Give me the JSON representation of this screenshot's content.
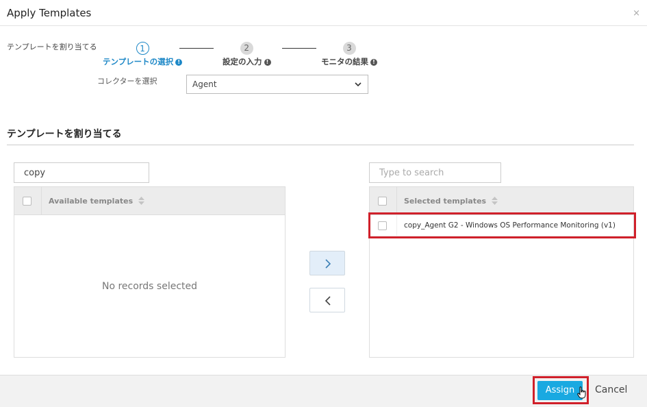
{
  "dialog": {
    "title": "Apply Templates",
    "close_glyph": "×"
  },
  "assign_label": "テンプレートを割り当てる",
  "steps": [
    {
      "number": "1",
      "label": "テンプレートの選択",
      "state": "active"
    },
    {
      "number": "2",
      "label": "設定の入力",
      "state": "inactive"
    },
    {
      "number": "3",
      "label": "モニタの結果",
      "state": "inactive"
    }
  ],
  "collector": {
    "label": "コレクターを選択",
    "value": "Agent"
  },
  "section_title": "テンプレートを割り当てる",
  "available": {
    "search_value": "copy",
    "column_header": "Available templates",
    "empty_text": "No records selected"
  },
  "selected": {
    "search_placeholder": "Type to search",
    "column_header": "Selected templates",
    "rows": [
      "copy_Agent G2 - Windows OS Performance Monitoring (v1)"
    ]
  },
  "footer": {
    "assign_label": "Assign",
    "cancel_label": "Cancel"
  },
  "colors": {
    "accent": "#1e88c7",
    "button": "#19a9e1",
    "highlight": "#d0202a"
  },
  "icons": [
    "info-icon",
    "chevron-down-icon",
    "sort-icon",
    "arrow-right-icon",
    "arrow-left-icon",
    "hand-cursor-icon"
  ]
}
